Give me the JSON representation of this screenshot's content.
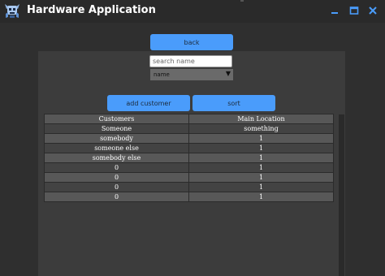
{
  "window": {
    "title": "Hardware Application"
  },
  "buttons": {
    "back": "back",
    "add_customer": "add customer",
    "sort": "sort"
  },
  "search": {
    "placeholder": "search name",
    "value": ""
  },
  "sort_field": {
    "selected": "name"
  },
  "table": {
    "headers": [
      "Customers",
      "Main Location"
    ],
    "rows": [
      [
        "Someone",
        "something"
      ],
      [
        "somebody",
        "1"
      ],
      [
        "someone else",
        "1"
      ],
      [
        "somebody else",
        "1"
      ],
      [
        "0",
        "1"
      ],
      [
        "0",
        "1"
      ],
      [
        "0",
        "1"
      ],
      [
        "0",
        "1"
      ]
    ]
  },
  "colors": {
    "accent": "#4a9cfb",
    "window_bg": "#2f2f2f",
    "panel_bg": "#3c3c3c",
    "titlebar_bg": "#2a2a2a"
  },
  "icons": {
    "app": "robot-skull-icon",
    "minimize": "minimize-icon",
    "maximize": "maximize-icon",
    "close": "close-icon"
  }
}
